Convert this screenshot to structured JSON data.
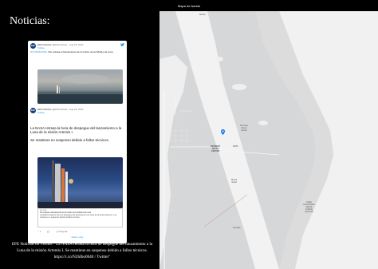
{
  "topbar": {
    "title": "Mapa de tweets"
  },
  "section": {
    "heading": "Noticias:"
  },
  "tweet1": {
    "avatar": "EFE",
    "account": "EFE Noticias",
    "handle": "@EFEnoticias · Aug 29, 2022",
    "follow": "Follow",
    "tag": "#ÚLTIMAHORA",
    "text": "| Se retrasa el lanzamiento de la misión de la NASA a la Luna"
  },
  "tweet2": {
    "avatar": "EFE",
    "account": "EFE Noticias",
    "handle": "@EFEnoticias · Aug 29, 2022",
    "follow": "Follow",
    "text1": "La NASA retrasa la hora de despegue del lanzamiento a la Luna de la misión Artemis I.",
    "text2": "Se mantiene en suspenso debido a fallos técnicos."
  },
  "quote": {
    "source": "efe.com",
    "title": "Se retrasa el lanzamiento de la misión de la NASA a la Luna",
    "desc": "La NASA retrasó la hora de despegue del lanzamiento a la Luna de la misión Artemis I y la mantiene en suspenso debido a fallos técnicos..."
  },
  "actions": {
    "likes": "♡ 1",
    "reply": "💬",
    "copy": "🔗 Copy link"
  },
  "read_more": "Read 1 reply",
  "caption": "EFE Noticias on Twitter: \"La NASA retrasa la hora de despegue del lanzamiento a la Luna de la misión Artemis I. Se mantiene en suspenso debido a fallos técnicos. https://t.co/N2hIbo0640 / Twitter\"",
  "map": {
    "labels": {
      "top": "MILES",
      "center": "KENNEDY\nSPACE\nCENTER",
      "kennedy_right": "Kennedy\nSpace\nCenter",
      "mims": "MIMS",
      "merritt": "Merritt\nIsland",
      "titusville": "Titusville",
      "cape": "CAPE\nCANAVERAL\nSPACE\nFORCE\nSTATION"
    }
  },
  "colors": {
    "accent": "#1d9bf0",
    "pin": "#1a73e8"
  }
}
